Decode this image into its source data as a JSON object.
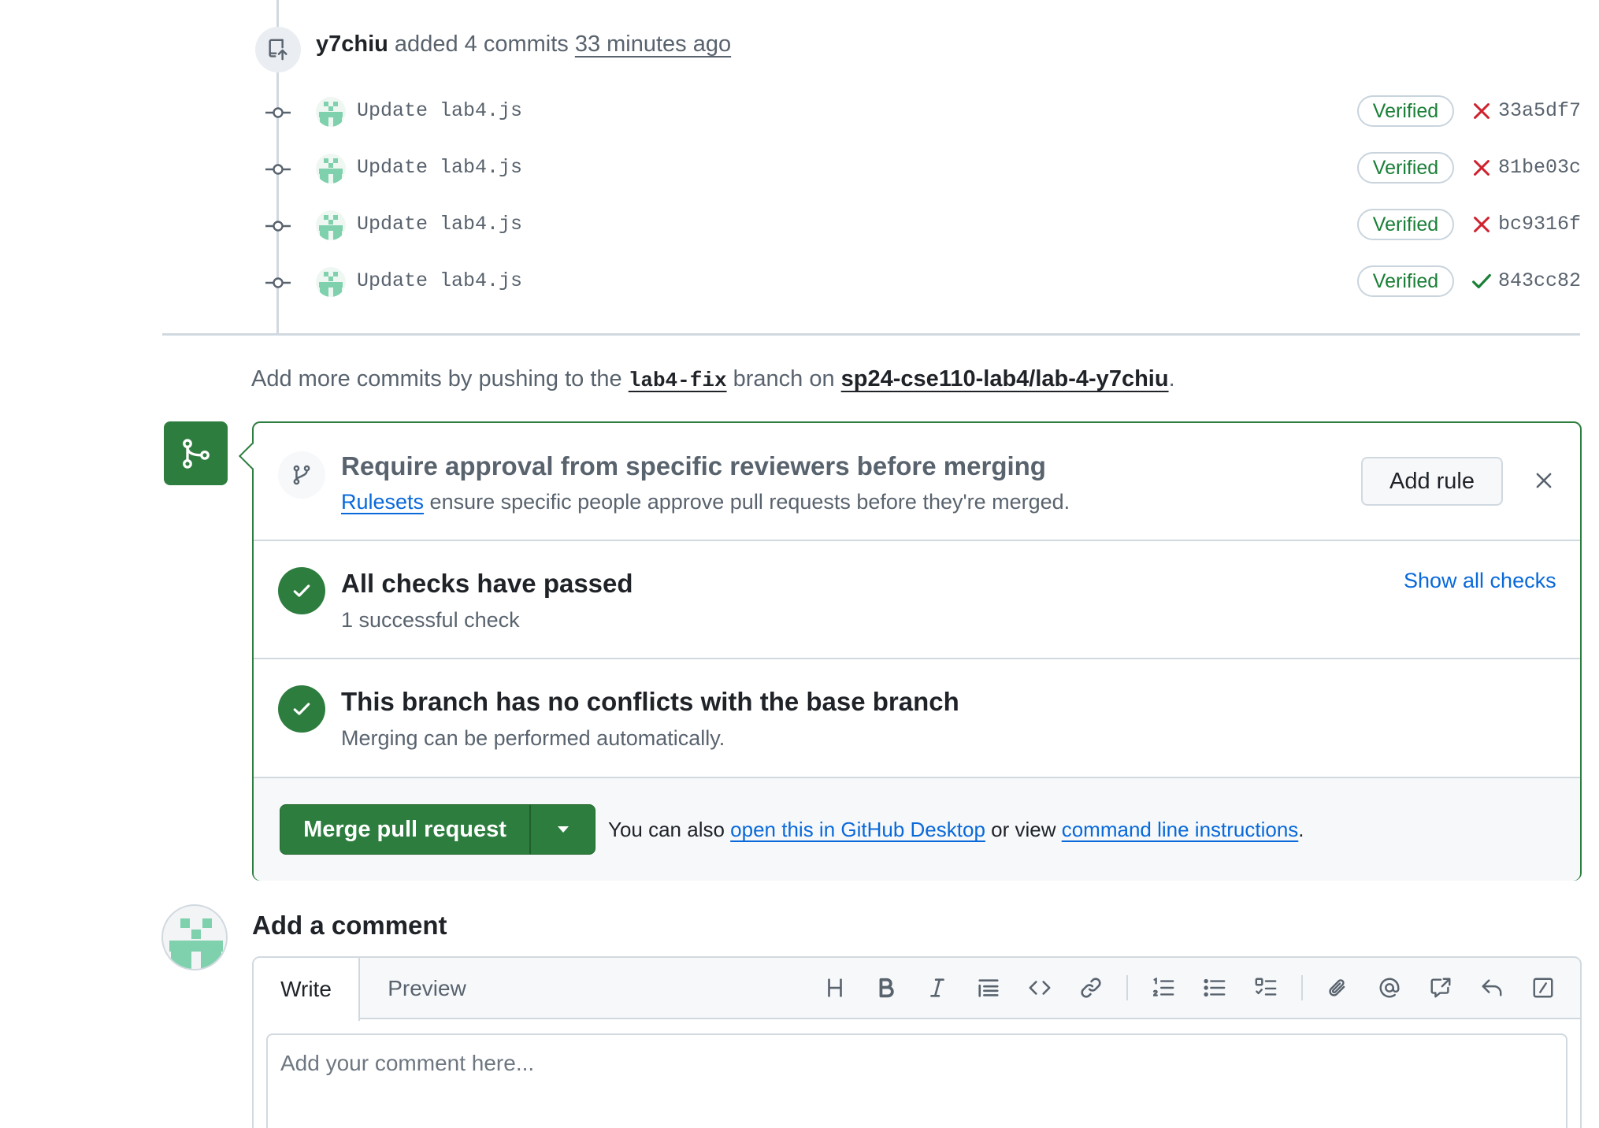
{
  "timeline": {
    "push_event": {
      "user": "y7chiu",
      "action": " added 4 commits ",
      "time": "33 minutes ago"
    },
    "commits": [
      {
        "message": "Update lab4.js",
        "verified_label": "Verified",
        "status": "failed",
        "sha": "33a5df7"
      },
      {
        "message": "Update lab4.js",
        "verified_label": "Verified",
        "status": "failed",
        "sha": "81be03c"
      },
      {
        "message": "Update lab4.js",
        "verified_label": "Verified",
        "status": "failed",
        "sha": "bc9316f"
      },
      {
        "message": "Update lab4.js",
        "verified_label": "Verified",
        "status": "success",
        "sha": "843cc82"
      }
    ]
  },
  "hint": {
    "prefix": "Add more commits by pushing to the ",
    "branch": "lab4-fix",
    "middle": " branch on ",
    "repo": "sp24-cse110-lab4/lab-4-y7chiu",
    "suffix": "."
  },
  "merge_box": {
    "ruleset": {
      "title": "Require approval from specific reviewers before merging",
      "link": "Rulesets",
      "description": " ensure specific people approve pull requests before they're merged.",
      "add_rule_label": "Add rule"
    },
    "checks": {
      "title": "All checks have passed",
      "subtitle": "1 successful check",
      "show_all_label": "Show all checks"
    },
    "conflicts": {
      "title": "This branch has no conflicts with the base branch",
      "subtitle": "Merging can be performed automatically."
    },
    "merge": {
      "button_label": "Merge pull request",
      "also_prefix": "You can also ",
      "desktop_link": "open this in GitHub Desktop",
      "also_middle": " or view ",
      "cli_link": "command line instructions",
      "also_suffix": "."
    }
  },
  "comment": {
    "title": "Add a comment",
    "tab_write": "Write",
    "tab_preview": "Preview",
    "placeholder": "Add your comment here...",
    "toolbar_icons": [
      "heading-icon",
      "bold-icon",
      "italic-icon",
      "quote-icon",
      "code-icon",
      "link-icon",
      "ordered-list-icon",
      "unordered-list-icon",
      "task-list-icon",
      "attach-icon",
      "mention-icon",
      "cross-reference-icon",
      "saved-reply-icon",
      "slash-command-icon"
    ]
  },
  "colors": {
    "success": "#1a7f37",
    "merge_green": "#2d7d3f",
    "danger": "#cf222e",
    "link": "#0969da",
    "muted": "#59636e"
  }
}
